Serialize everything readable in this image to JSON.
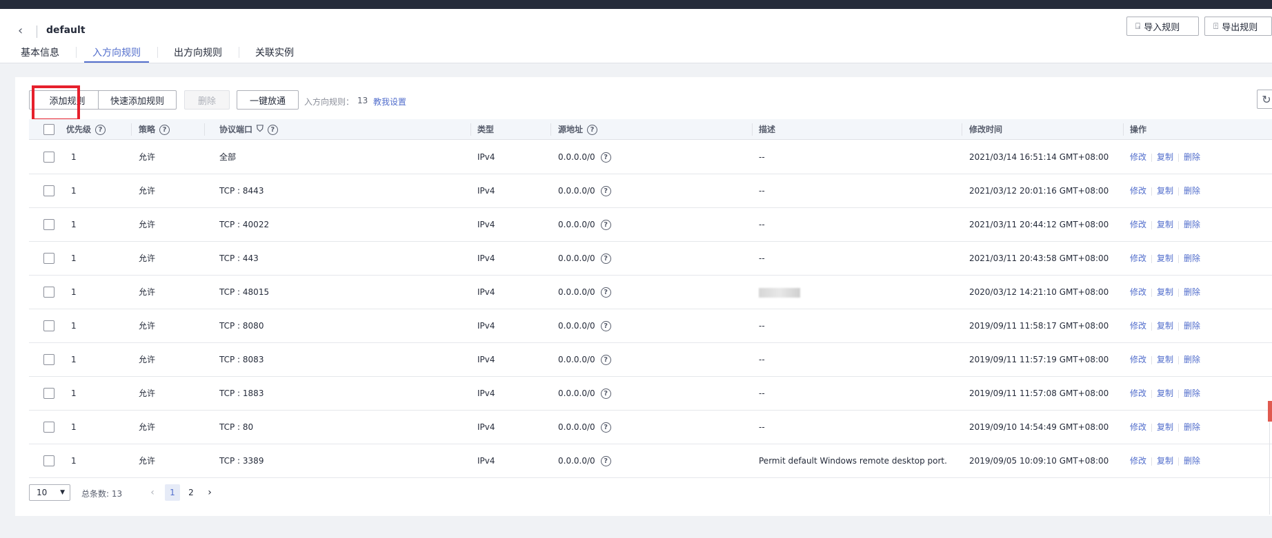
{
  "header": {
    "back_icon": "chevron-left-icon",
    "title": "default",
    "import_label": "导入规则",
    "export_label": "导出规则"
  },
  "tabs": [
    {
      "label": "基本信息",
      "active": false
    },
    {
      "label": "入方向规则",
      "active": true
    },
    {
      "label": "出方向规则",
      "active": false
    },
    {
      "label": "关联实例",
      "active": false
    }
  ],
  "toolbar": {
    "add_rule": "添加规则",
    "quick_add_rule": "快速添加规则",
    "delete": "删除",
    "allow_all": "一键放通",
    "rule_count_label": "入方向规则：",
    "rule_count": "13",
    "help_link": "教我设置"
  },
  "table": {
    "columns": {
      "priority": "优先级",
      "policy": "策略",
      "protocol_port": "协议端口",
      "type": "类型",
      "source": "源地址",
      "description": "描述",
      "modified": "修改时间",
      "actions": "操作"
    },
    "action_labels": {
      "edit": "修改",
      "copy": "复制",
      "delete": "删除"
    },
    "rows": [
      {
        "priority": "1",
        "policy": "允许",
        "protocol_port": "全部",
        "type": "IPv4",
        "source": "0.0.0.0/0",
        "description": "--",
        "modified": "2021/03/14 16:51:14 GMT+08:00"
      },
      {
        "priority": "1",
        "policy": "允许",
        "protocol_port": "TCP : 8443",
        "type": "IPv4",
        "source": "0.0.0.0/0",
        "description": "--",
        "modified": "2021/03/12 20:01:16 GMT+08:00"
      },
      {
        "priority": "1",
        "policy": "允许",
        "protocol_port": "TCP : 40022",
        "type": "IPv4",
        "source": "0.0.0.0/0",
        "description": "--",
        "modified": "2021/03/11 20:44:12 GMT+08:00"
      },
      {
        "priority": "1",
        "policy": "允许",
        "protocol_port": "TCP : 443",
        "type": "IPv4",
        "source": "0.0.0.0/0",
        "description": "--",
        "modified": "2021/03/11 20:43:58 GMT+08:00"
      },
      {
        "priority": "1",
        "policy": "允许",
        "protocol_port": "TCP : 48015",
        "type": "IPv4",
        "source": "0.0.0.0/0",
        "description": "",
        "modified": "2020/03/12 14:21:10 GMT+08:00",
        "description_blurred": true
      },
      {
        "priority": "1",
        "policy": "允许",
        "protocol_port": "TCP : 8080",
        "type": "IPv4",
        "source": "0.0.0.0/0",
        "description": "--",
        "modified": "2019/09/11 11:58:17 GMT+08:00"
      },
      {
        "priority": "1",
        "policy": "允许",
        "protocol_port": "TCP : 8083",
        "type": "IPv4",
        "source": "0.0.0.0/0",
        "description": "--",
        "modified": "2019/09/11 11:57:19 GMT+08:00"
      },
      {
        "priority": "1",
        "policy": "允许",
        "protocol_port": "TCP : 1883",
        "type": "IPv4",
        "source": "0.0.0.0/0",
        "description": "--",
        "modified": "2019/09/11 11:57:08 GMT+08:00"
      },
      {
        "priority": "1",
        "policy": "允许",
        "protocol_port": "TCP : 80",
        "type": "IPv4",
        "source": "0.0.0.0/0",
        "description": "--",
        "modified": "2019/09/10 14:54:49 GMT+08:00"
      },
      {
        "priority": "1",
        "policy": "允许",
        "protocol_port": "TCP : 3389",
        "type": "IPv4",
        "source": "0.0.0.0/0",
        "description": "Permit default Windows remote desktop port.",
        "modified": "2019/09/05 10:09:10 GMT+08:00"
      }
    ]
  },
  "pagination": {
    "page_size": "10",
    "total_label": "总条数: 13",
    "pages": [
      "1",
      "2"
    ],
    "current_page": "1"
  },
  "colors": {
    "accent": "#526ecc",
    "highlight": "#e6202c",
    "topbar": "#252b3a"
  }
}
